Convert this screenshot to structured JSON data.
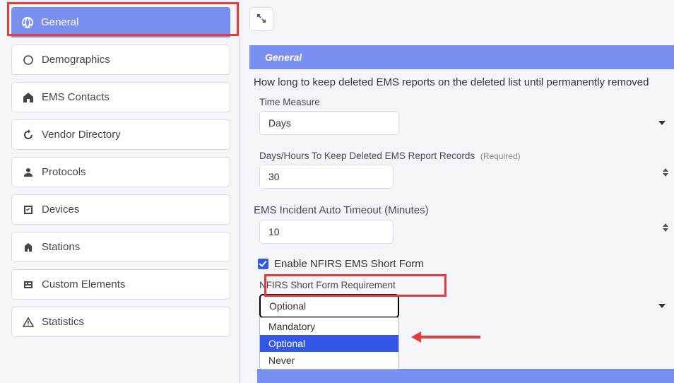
{
  "sidebar": {
    "items": [
      {
        "label": "General",
        "icon": "globe-icon",
        "active": true
      },
      {
        "label": "Demographics",
        "icon": "radio-icon"
      },
      {
        "label": "EMS Contacts",
        "icon": "home-icon"
      },
      {
        "label": "Vendor Directory",
        "icon": "history-icon"
      },
      {
        "label": "Protocols",
        "icon": "person-icon"
      },
      {
        "label": "Devices",
        "icon": "checkbox-icon"
      },
      {
        "label": "Stations",
        "icon": "building-icon"
      },
      {
        "label": "Custom Elements",
        "icon": "elements-icon"
      },
      {
        "label": "Statistics",
        "icon": "warning-icon"
      }
    ]
  },
  "panel": {
    "title": "General",
    "description": "How long to keep deleted EMS reports on the deleted list until permanently removed"
  },
  "fields": {
    "time_measure": {
      "label": "Time Measure",
      "value": "Days"
    },
    "keep_records": {
      "label": "Days/Hours To Keep Deleted EMS Report Records",
      "req": "(Required)",
      "value": "30"
    },
    "timeout": {
      "label": "EMS Incident Auto Timeout (Minutes)",
      "value": "10"
    },
    "enable_short": {
      "label": "Enable NFIRS EMS Short Form",
      "checked": true
    },
    "requirement": {
      "label": "NFIRS Short Form Requirement",
      "value": "Optional",
      "options": [
        "Mandatory",
        "Optional",
        "Never"
      ]
    }
  }
}
